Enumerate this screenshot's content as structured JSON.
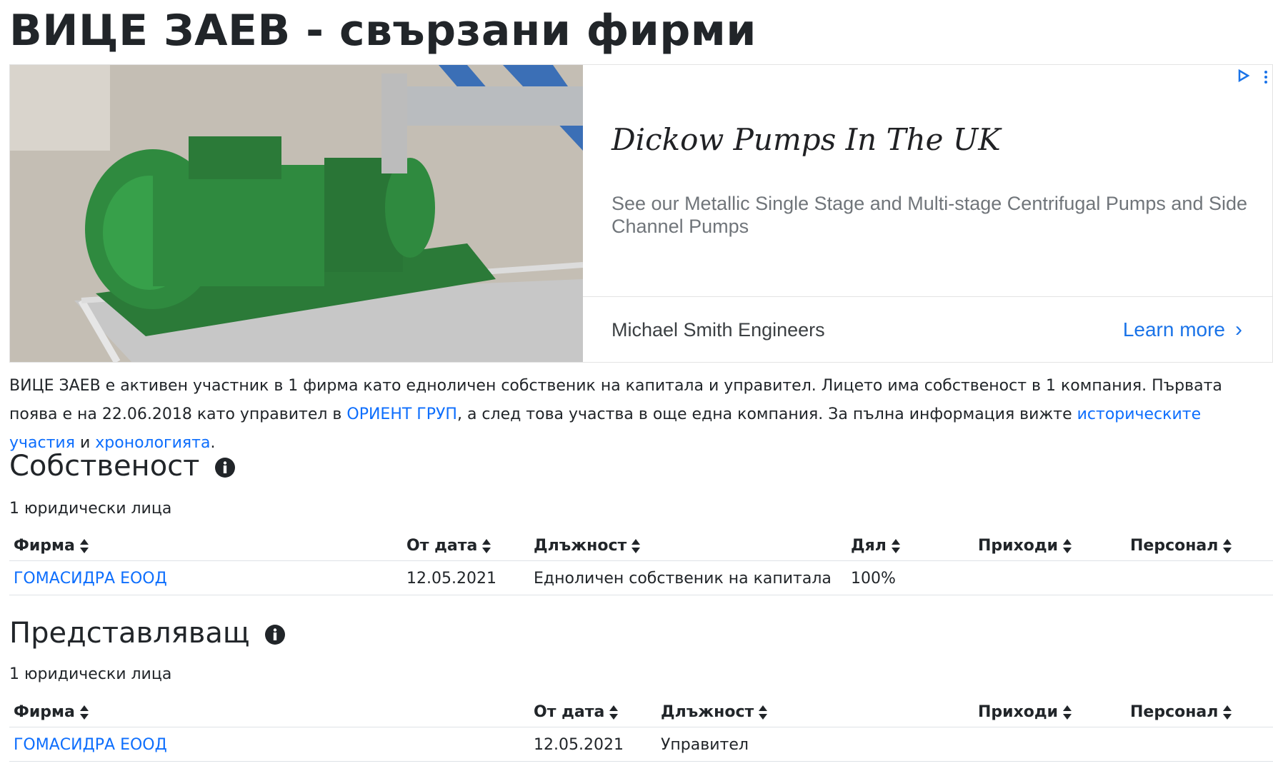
{
  "page_title": "ВИЦЕ ЗАЕВ - свързани фирми",
  "ad": {
    "headline": "Dickow Pumps In The UK",
    "description": "See our Metallic Single Stage and Multi-stage Centrifugal Pumps and Side Channel Pumps",
    "advertiser": "Michael Smith Engineers",
    "cta": "Learn more",
    "colors": {
      "accent": "#1a73e8",
      "pump_green": "#2f8a3f"
    }
  },
  "intro": {
    "part1": "ВИЦЕ ЗАЕВ е активен участник в 1 фирма като едноличен собственик на капитала и управител. Лицето има собственост в 1 компания. Първата поява е на 22.06.2018 като управител в ",
    "link1": "ОРИЕНТ ГРУП",
    "part2": ", а след това участва в още една компания. За пълна информация вижте ",
    "link2": "историческите участия",
    "part3": " и ",
    "link3": "хронологията",
    "part4": "."
  },
  "ownership": {
    "title": "Собственост",
    "count": "1 юридически лица",
    "headers": [
      "Фирма",
      "От дата",
      "Длъжност",
      "Дял",
      "Приходи",
      "Персонал"
    ],
    "rows": [
      {
        "company": "ГОМАСИДРА ЕООД",
        "date": "12.05.2021",
        "role": "Едноличен собственик на капитала",
        "share": "100%",
        "revenue": "",
        "staff": ""
      }
    ]
  },
  "representative": {
    "title": "Представляващ",
    "count": "1 юридически лица",
    "headers": [
      "Фирма",
      "От дата",
      "Длъжност",
      "Приходи",
      "Персонал"
    ],
    "rows": [
      {
        "company": "ГОМАСИДРА ЕООД",
        "date": "12.05.2021",
        "role": "Управител",
        "revenue": "",
        "staff": ""
      }
    ]
  }
}
